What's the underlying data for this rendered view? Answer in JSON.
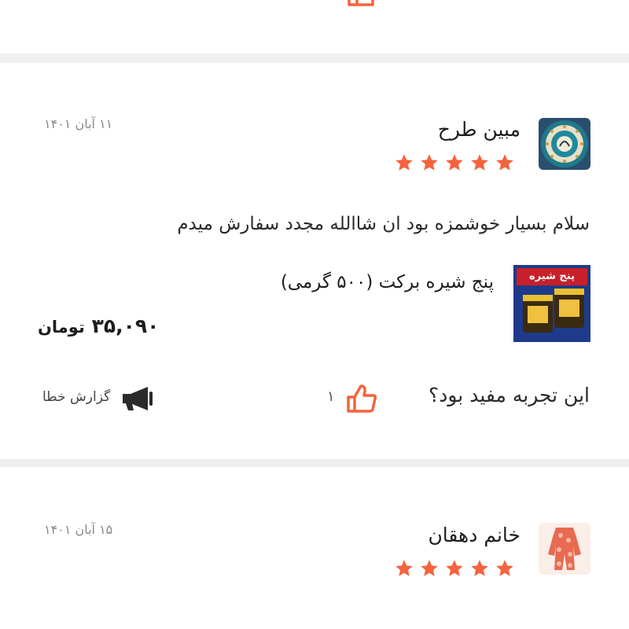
{
  "colors": {
    "star": "#f4633e",
    "like_icon": "#f4633e",
    "divider": "#f0f0f0"
  },
  "reviews": [
    {
      "author": "مبین طرح",
      "date": "۱۱ آبان ۱۴۰۱",
      "rating": 5,
      "text": "سلام بسیار خوشمزه بود ان شاالله مجدد سفارش میدم",
      "product": {
        "name": "پنج شیره برکت (۵۰۰ گرمی)",
        "image_label": "پنج شیره",
        "price": "۳۵,۰۹۰",
        "currency": "تومان"
      },
      "helpful_question": "این تجربه مفید بود؟",
      "like_count": "۱",
      "report_label": "گزارش خطا",
      "avatar_icon": "calligraphy-plate-icon"
    },
    {
      "author": "خانم دهقان",
      "date": "۱۵ آبان ۱۴۰۱",
      "rating": 5,
      "avatar_icon": "floral-outfit-icon"
    }
  ]
}
